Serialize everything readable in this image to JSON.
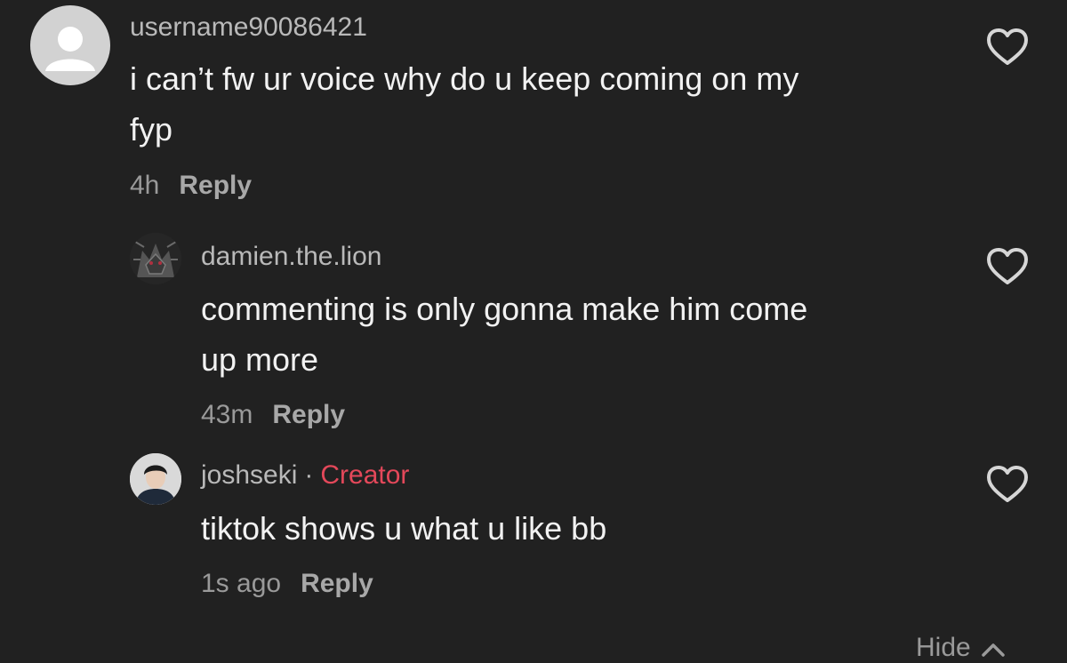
{
  "comments": [
    {
      "username": "username90086421",
      "text_line1": "i can’t fw ur voice why do u keep coming on my",
      "text_line2": "fyp",
      "time": "4h",
      "reply_label": "Reply"
    },
    {
      "username": "damien.the.lion",
      "text_line1": "commenting is only gonna make him come",
      "text_line2": "up more",
      "time": "43m",
      "reply_label": "Reply"
    },
    {
      "username": "joshseki",
      "separator": "·",
      "badge": "Creator",
      "text_line1": "tiktok shows u what u like bb",
      "time": "1s ago",
      "reply_label": "Reply"
    }
  ],
  "footer": {
    "hide_label": "Hide"
  },
  "icons": {
    "like": "heart-outline-icon",
    "hide": "chevron-up-icon"
  },
  "colors": {
    "background": "#212121",
    "creator_badge": "#e4485a",
    "secondary_text": "#9a9a9a"
  }
}
